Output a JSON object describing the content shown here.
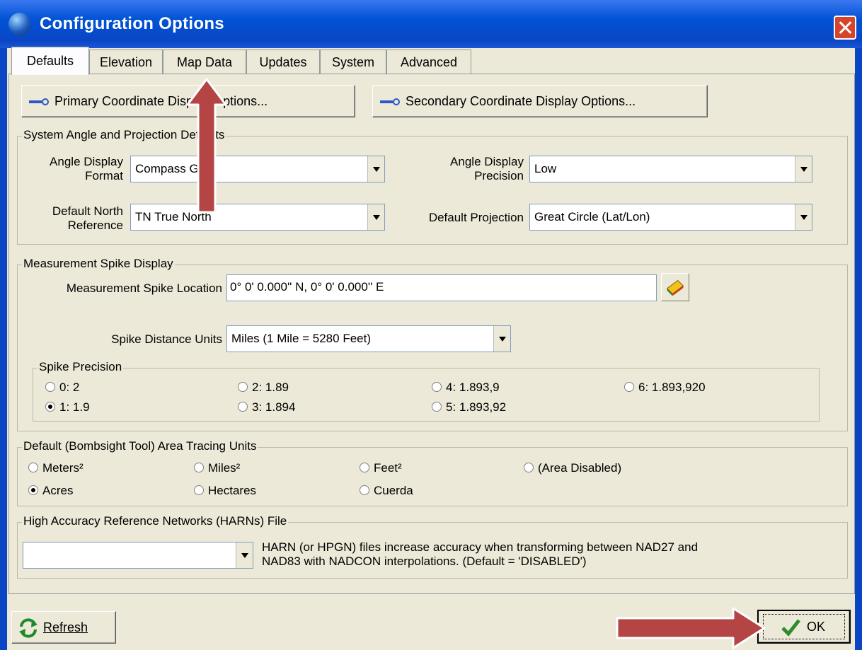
{
  "window": {
    "title": "Configuration Options"
  },
  "tabs": [
    "Defaults",
    "Elevation",
    "Map Data",
    "Updates",
    "System",
    "Advanced"
  ],
  "buttons": {
    "primary": "Primary Coordinate Display Options...",
    "secondary": "Secondary Coordinate Display Options...",
    "refresh": "Refresh",
    "ok": "OK"
  },
  "angle_group": {
    "legend": "System Angle and Projection Defaults",
    "angle_format_label_1": "Angle Display",
    "angle_format_label_2": "Format",
    "angle_format_value": "Compass Grid",
    "angle_precision_label_1": "Angle Display",
    "angle_precision_label_2": "Precision",
    "angle_precision_value": "Low",
    "north_label_1": "Default North",
    "north_label_2": "Reference",
    "north_value": "TN  True North",
    "projection_label": "Default Projection",
    "projection_value": "Great Circle (Lat/Lon)"
  },
  "spike_group": {
    "legend": "Measurement Spike Display",
    "location_label": "Measurement Spike Location",
    "location_value": "0° 0' 0.000'' N, 0° 0' 0.000'' E",
    "units_label": "Spike Distance Units",
    "units_value": "Miles (1 Mile = 5280 Feet)",
    "precision_legend": "Spike Precision",
    "precision_options": [
      "0: 2",
      "1: 1.9",
      "2: 1.89",
      "3: 1.894",
      "4: 1.893,9",
      "5: 1.893,92",
      "6: 1.893,920"
    ],
    "precision_selected": "1: 1.9"
  },
  "area_group": {
    "legend": "Default (Bombsight Tool) Area Tracing Units",
    "options": [
      "Meters²",
      "Acres",
      "Miles²",
      "Hectares",
      "Feet²",
      "Cuerda",
      "(Area Disabled)"
    ],
    "selected": "Acres"
  },
  "harn_group": {
    "legend": "High Accuracy Reference Networks (HARNs)  File",
    "value": "",
    "description_1": "HARN (or HPGN) files increase accuracy when transforming between NAD27 and",
    "description_2": "NAD83 with NADCON interpolations. (Default = 'DISABLED')"
  },
  "icons": [
    "globe-icon",
    "close-icon",
    "key-icon",
    "book-icon",
    "refresh-icon",
    "checkmark-icon",
    "up-arrow-icon",
    "right-arrow-icon"
  ],
  "colors": {
    "titlebar": "#0a46c4",
    "dialog": "#ece9d8",
    "arrow": "#b54545"
  }
}
